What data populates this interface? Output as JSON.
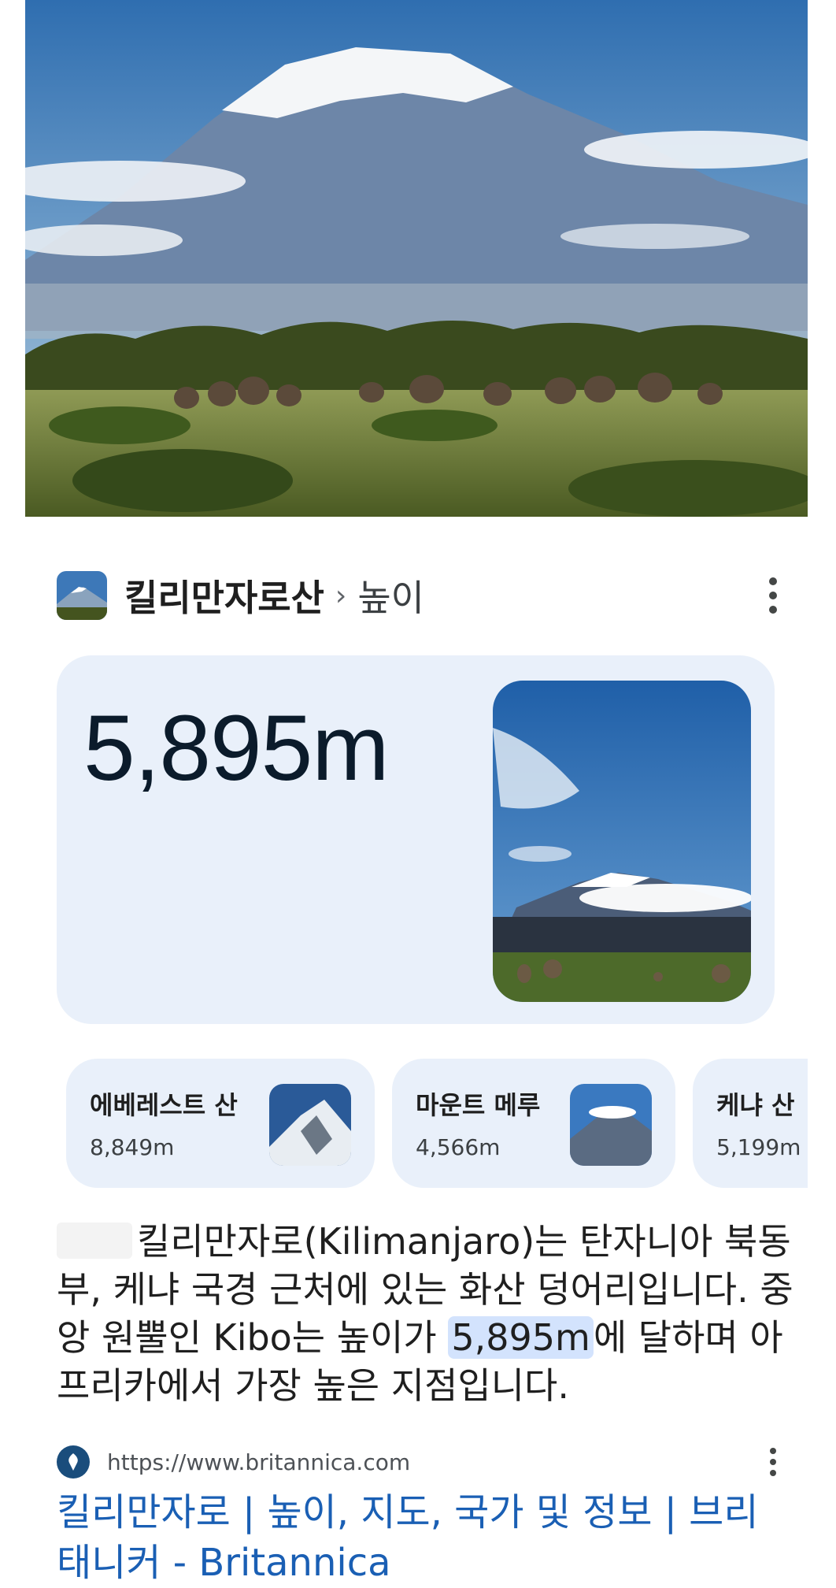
{
  "header": {
    "title": "킬리만자로산",
    "separator": "›",
    "subtitle": "높이"
  },
  "answer": {
    "value": "5,895m"
  },
  "related": [
    {
      "name": "에베레스트 산",
      "value": "8,849m"
    },
    {
      "name": "마운트 메루",
      "value": "4,566m"
    },
    {
      "name": "케냐 산",
      "value": "5,199m"
    }
  ],
  "description": {
    "part1": "킬리만자로(Kilimanjaro)는 탄자니아 북동부, 케냐 국경 근처에 있는 화산 덩어리입니다. 중앙 원뿔인 Kibo는 높이가 ",
    "highlight": "5,895m",
    "part2": "에 달하며 아프리카에서 가장 높은 지점입니다."
  },
  "source": {
    "url": "https://www.britannica.com",
    "title": "킬리만자로 | 높이, 지도, 국가 및 정보 | 브리태니커 - Britannica"
  },
  "colors": {
    "card_bg": "#e9f0fa",
    "highlight": "#d3e3fd",
    "link": "#1a5fb4"
  }
}
